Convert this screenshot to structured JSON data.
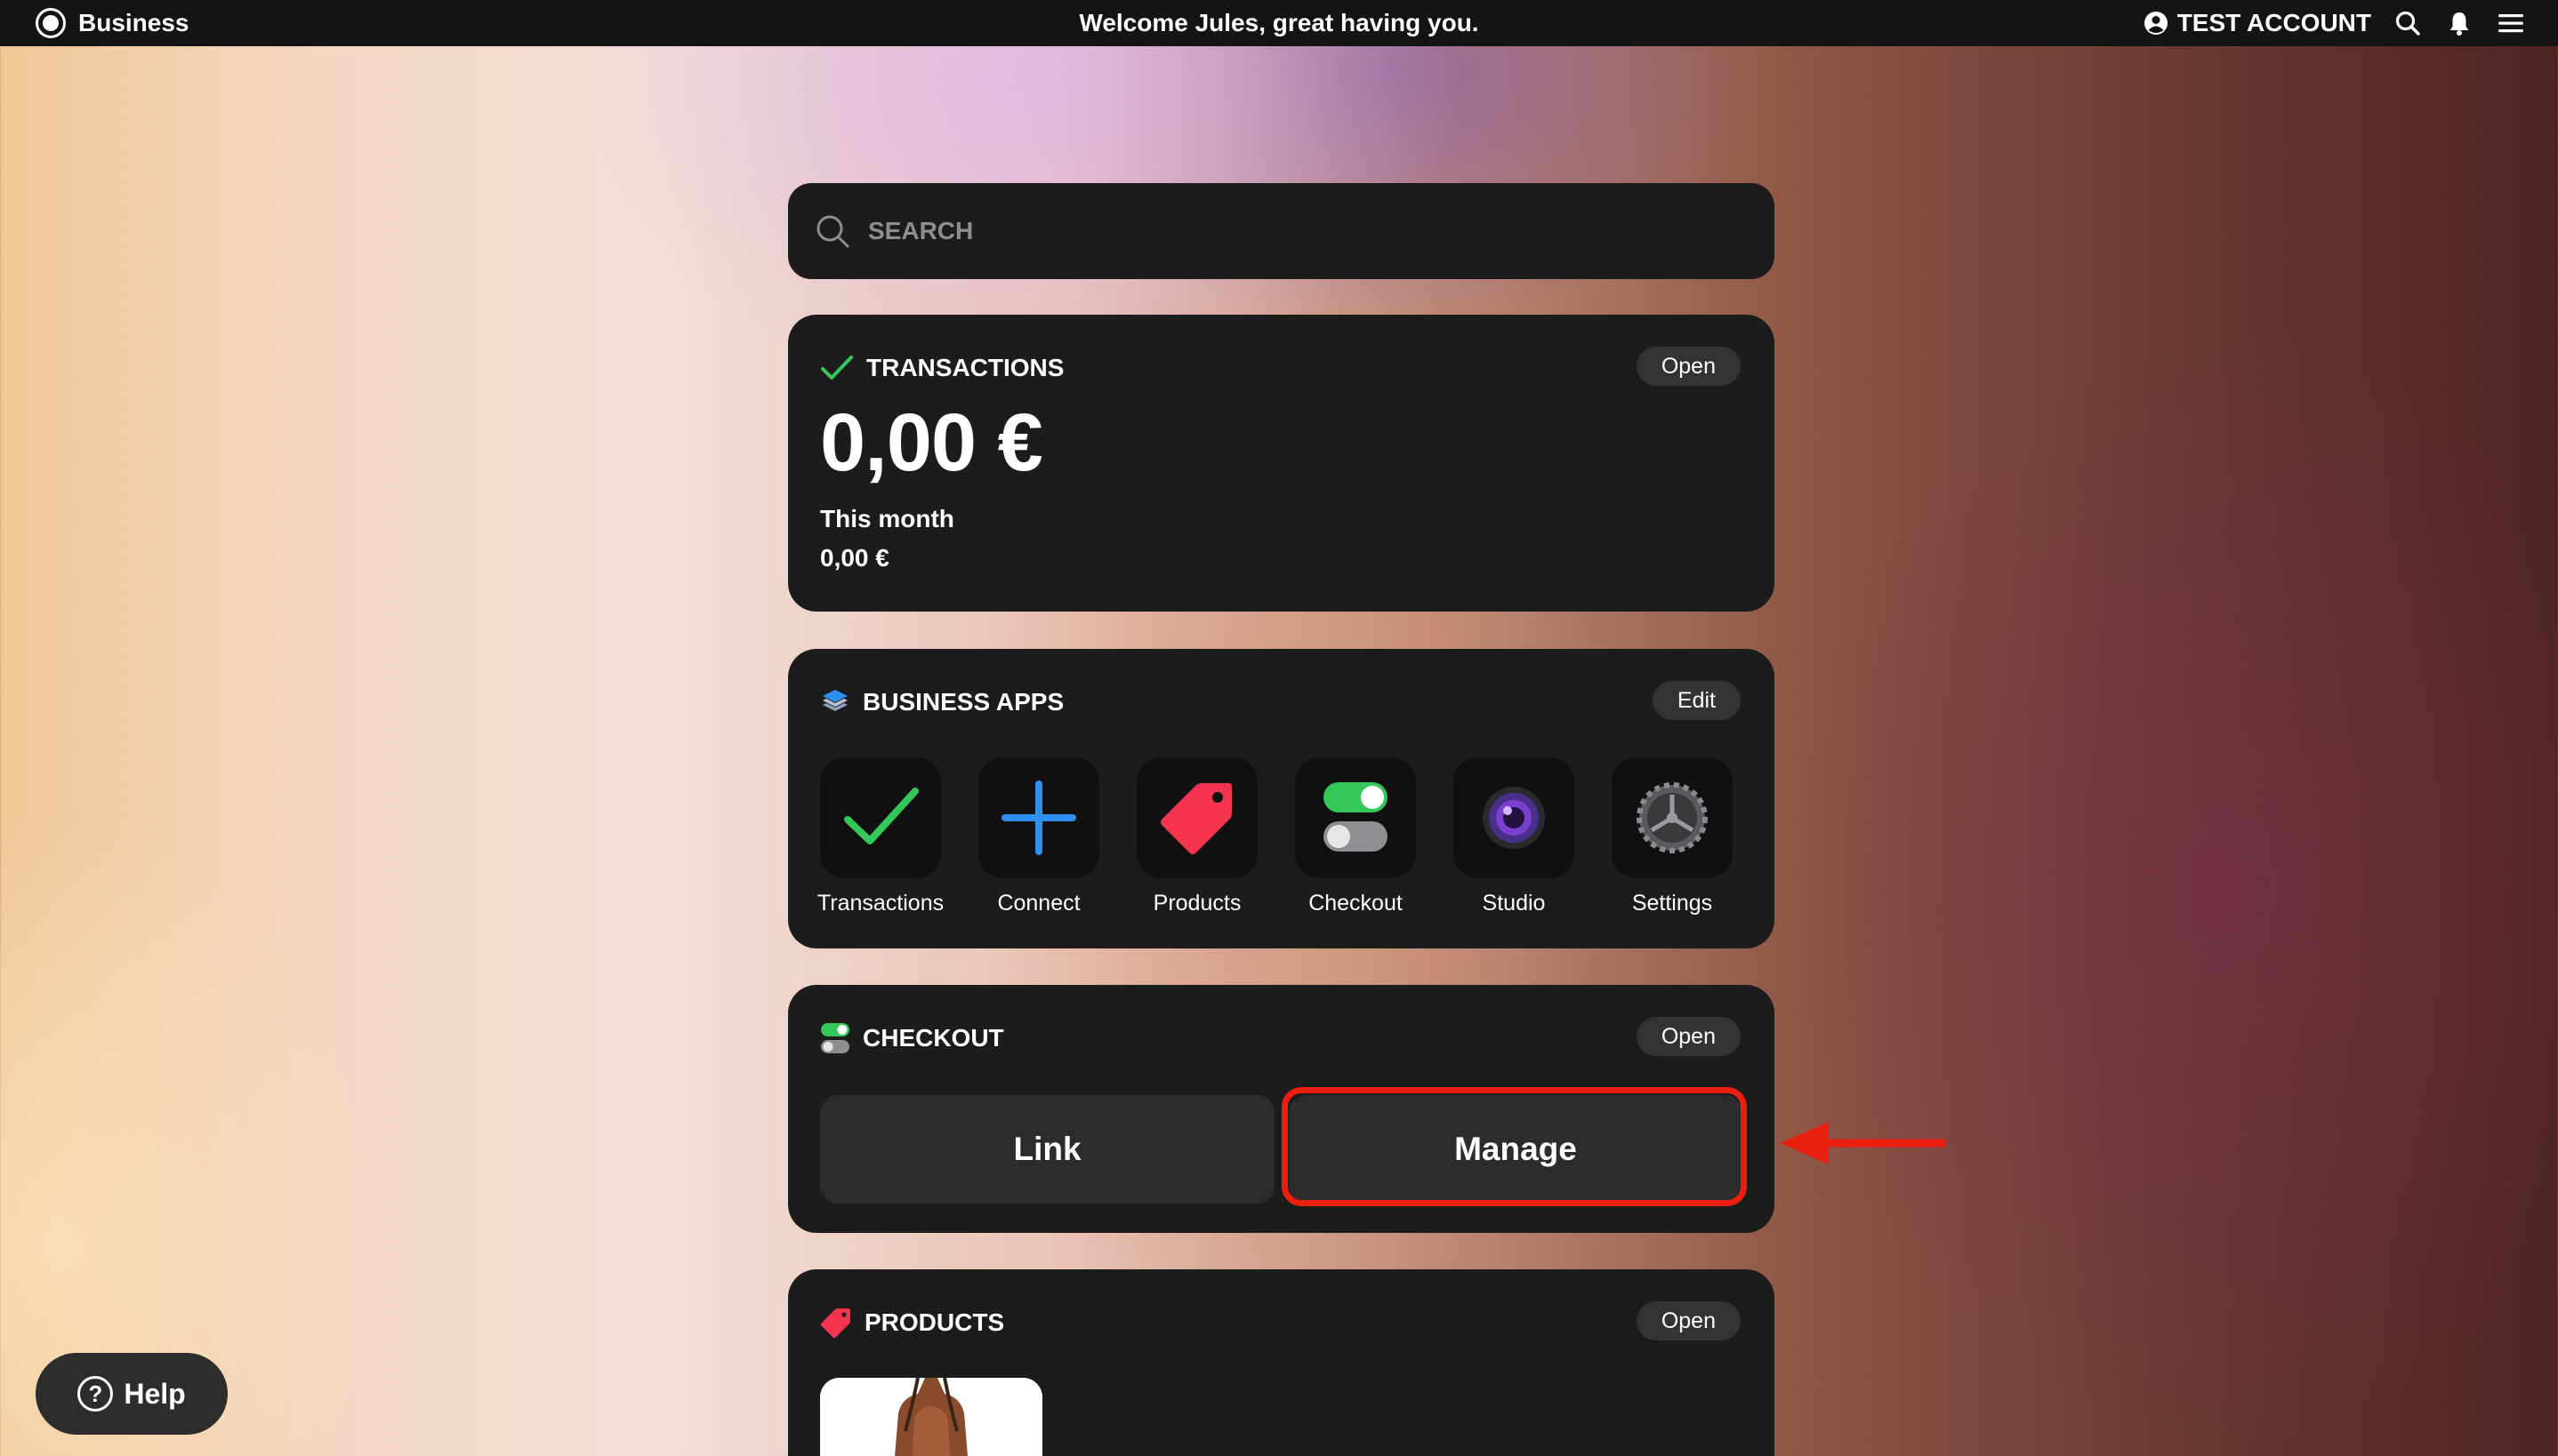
{
  "topbar": {
    "brand": "Business",
    "welcome": "Welcome Jules, great having you.",
    "account": "TEST ACCOUNT"
  },
  "search": {
    "placeholder": "SEARCH"
  },
  "transactions": {
    "title": "TRANSACTIONS",
    "open_label": "Open",
    "amount": "0,00 €",
    "period_label": "This month",
    "period_value": "0,00 €"
  },
  "business_apps": {
    "title": "BUSINESS APPS",
    "edit_label": "Edit",
    "apps": [
      {
        "label": "Transactions",
        "icon": "checkmark-icon"
      },
      {
        "label": "Connect",
        "icon": "plus-icon"
      },
      {
        "label": "Products",
        "icon": "tag-icon"
      },
      {
        "label": "Checkout",
        "icon": "toggle-icon"
      },
      {
        "label": "Studio",
        "icon": "camera-lens-icon"
      },
      {
        "label": "Settings",
        "icon": "gear-icon"
      }
    ]
  },
  "checkout": {
    "title": "CHECKOUT",
    "open_label": "Open",
    "link_label": "Link",
    "manage_label": "Manage"
  },
  "products": {
    "title": "PRODUCTS",
    "open_label": "Open"
  },
  "help": {
    "label": "Help"
  },
  "colors": {
    "accent_green": "#34c759",
    "accent_blue": "#2f8ff0",
    "tag_red": "#f5344f",
    "highlight_red": "#ea1f10"
  }
}
